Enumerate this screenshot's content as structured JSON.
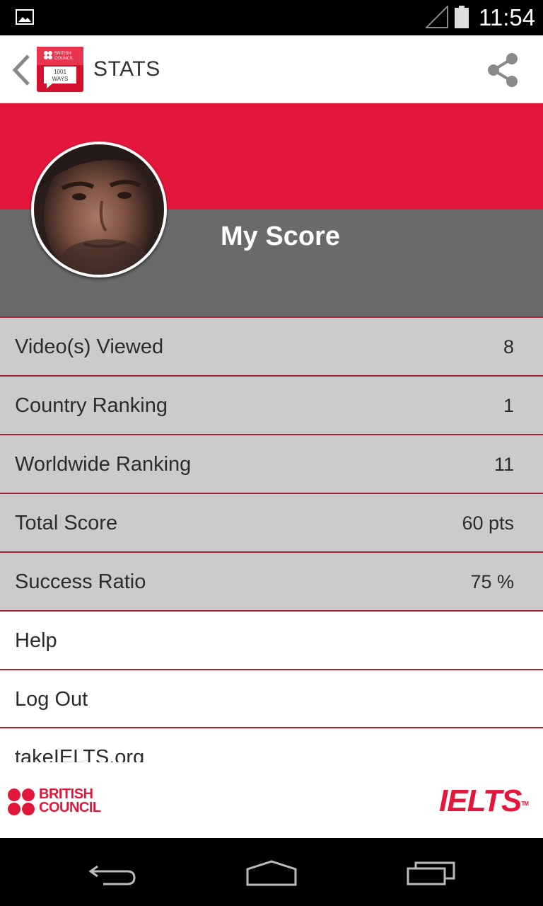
{
  "status_bar": {
    "time": "11:54"
  },
  "app_bar": {
    "title": "STATS",
    "logo": {
      "line1": "BRITISH",
      "line2": "COUNCIL",
      "line3": "1001",
      "line4": "WAYS"
    }
  },
  "header": {
    "title": "My Score"
  },
  "stats": [
    {
      "label": "Video(s) Viewed",
      "value": "8"
    },
    {
      "label": "Country Ranking",
      "value": "1"
    },
    {
      "label": "Worldwide Ranking",
      "value": "11"
    },
    {
      "label": "Total Score",
      "value": "60 pts"
    },
    {
      "label": "Success Ratio",
      "value": "75 %"
    }
  ],
  "menu": [
    {
      "label": "Help"
    },
    {
      "label": "Log Out"
    },
    {
      "label": "takeIELTS.org"
    }
  ],
  "footer": {
    "british_council_line1": "BRITISH",
    "british_council_line2": "COUNCIL",
    "ielts": "IELTS",
    "ielts_tm": "TM"
  },
  "colors": {
    "brand_red": "#e3173b",
    "header_gray": "#6a6a6a",
    "row_gray": "#cbcbcb",
    "divider": "#a62235"
  },
  "icons": {
    "back": "chevron-left-icon",
    "share": "share-icon",
    "gallery": "image-icon",
    "signal": "signal-icon",
    "battery": "battery-icon"
  }
}
